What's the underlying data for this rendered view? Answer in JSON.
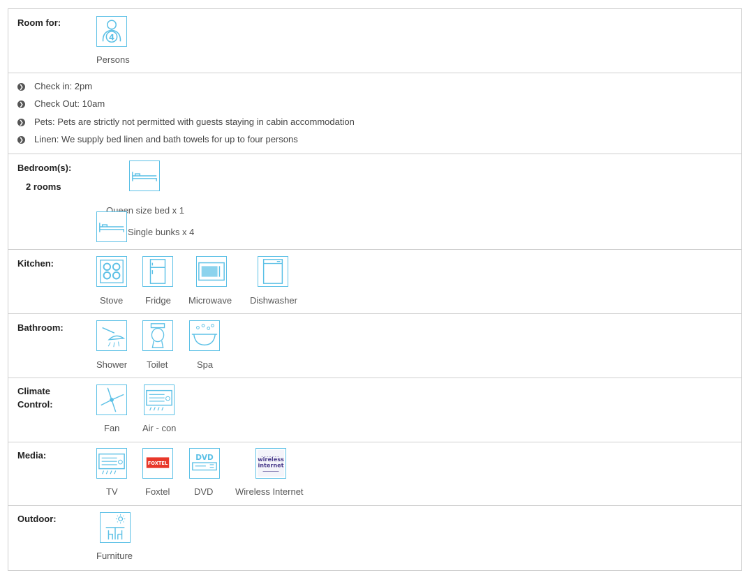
{
  "room_for": {
    "label": "Room for:",
    "count": "4",
    "caption": "Persons"
  },
  "policies": [
    "Check in: 2pm",
    "Check Out: 10am",
    "Pets: Pets are strictly not permitted with guests staying in cabin accommodation",
    "Linen: We supply bed linen and bath towels for up to four persons"
  ],
  "bedrooms": {
    "label": "Bedroom(s):",
    "rooms": "2 rooms",
    "items": [
      "Queen size bed x 1",
      "Single bunks x 4"
    ]
  },
  "kitchen": {
    "label": "Kitchen:",
    "items": [
      "Stove",
      "Fridge",
      "Microwave",
      "Dishwasher"
    ]
  },
  "bathroom": {
    "label": "Bathroom:",
    "items": [
      "Shower",
      "Toilet",
      "Spa"
    ]
  },
  "climate": {
    "label_line1": "Climate",
    "label_line2": "Control:",
    "items": [
      "Fan",
      "Air - con"
    ]
  },
  "media": {
    "label": "Media:",
    "items": [
      "TV",
      "Foxtel",
      "DVD",
      "Wireless Internet"
    ],
    "foxtel_logo": "FOXTEL",
    "dvd_logo": "DVD",
    "wifi_logo_line1": "wireless",
    "wifi_logo_line2": "internet"
  },
  "outdoor": {
    "label": "Outdoor:",
    "items": [
      "Furniture"
    ]
  },
  "colors": {
    "accent": "#5bc0e6",
    "border": "#cfcfcf",
    "foxtel": "#e8382a"
  }
}
